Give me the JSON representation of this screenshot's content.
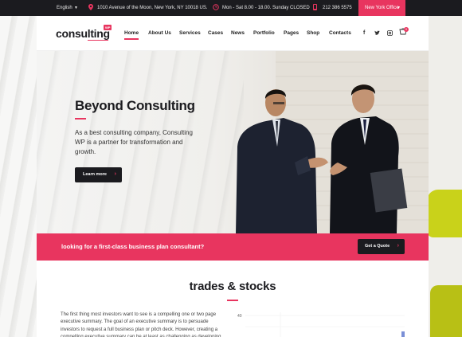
{
  "topbar": {
    "language": "English",
    "address": "1010 Avenue of the Moon, New York, NY 10018 US.",
    "hours": "Mon - Sat 8.00 - 18.00. Sunday CLOSED",
    "phone": "212 386 5575",
    "office": "New York Office"
  },
  "header": {
    "logo_text": "consulting",
    "logo_badge": "WP",
    "nav": [
      "Home",
      "About Us",
      "Services",
      "Cases",
      "News",
      "Portfolio",
      "Pages",
      "Shop",
      "Contacts"
    ],
    "active_nav": "Home",
    "cart_count": "0",
    "social_icons": [
      "facebook-icon",
      "twitter-icon",
      "instagram-icon"
    ]
  },
  "hero": {
    "title": "Beyond Consulting",
    "text": "As a best consulting company, Consulting WP is a partner for transformation and growth.",
    "button": "Learn more"
  },
  "cta": {
    "text": "looking for a first-class business plan consultant?",
    "button": "Get a Quote"
  },
  "section": {
    "title": "trades & stocks",
    "body": "The first thing most investors want to see is a compelling one or two page executive summary. The goal of an executive summary is to persuade investors to request a full business plan or pitch deck. However, creating a compelling executive summary can be at least as challenging as developing a complete"
  },
  "mini_chart": {
    "tick_label": "40"
  },
  "colors": {
    "accent": "#e8355f",
    "dark": "#1b1b1f"
  }
}
